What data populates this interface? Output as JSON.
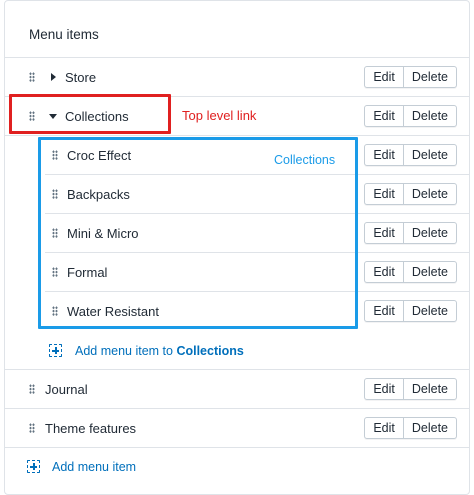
{
  "card": {
    "title": "Menu items"
  },
  "buttons": {
    "edit": "Edit",
    "delete": "Delete"
  },
  "top_items": [
    {
      "label": "Store",
      "expander": "collapsed"
    },
    {
      "label": "Collections",
      "expander": "expanded"
    },
    {
      "label": "Journal",
      "expander": "none"
    },
    {
      "label": "Theme features",
      "expander": "none"
    }
  ],
  "child_items": [
    {
      "label": "Croc Effect"
    },
    {
      "label": "Backpacks"
    },
    {
      "label": "Mini & Micro"
    },
    {
      "label": "Formal"
    },
    {
      "label": "Water Resistant"
    }
  ],
  "add_child": {
    "prefix": "Add menu item to ",
    "target": "Collections"
  },
  "add_top": {
    "label": "Add menu item"
  },
  "annotations": {
    "top_level": {
      "text": "Top level link",
      "color": "#e02020"
    },
    "collections": {
      "text": "Collections",
      "color": "#1a9be8"
    }
  },
  "colors": {
    "link": "#006fbb",
    "border": "#dfe3e8",
    "text": "#212b36"
  }
}
